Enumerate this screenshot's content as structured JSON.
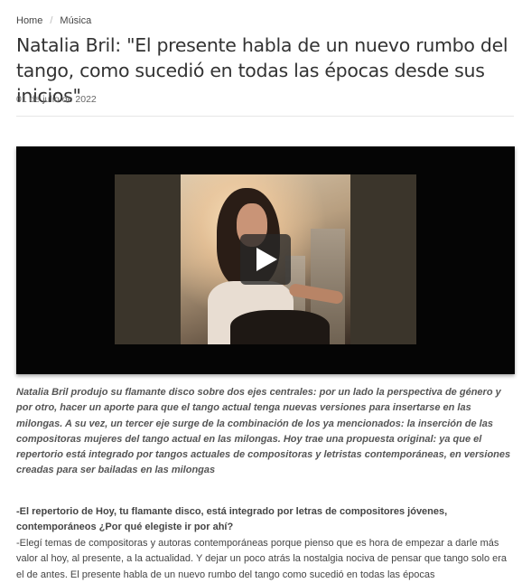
{
  "breadcrumb": {
    "home": "Home",
    "separator": "/",
    "section": "Música"
  },
  "article": {
    "title": "Natalia Bril: \"El presente habla de un nuevo rumbo del tango, como sucedió en todas las épocas desde sus inicios\"",
    "date": "01 de julio de 2022",
    "intro": "Natalia Bril produjo su flamante disco sobre dos ejes centrales: por un lado la perspectiva de género y por otro, hacer un aporte para que el tango actual tenga nuevas versiones para insertarse en las milongas. A su vez, un tercer eje surge de la combinación de los ya mencionados: la inserción de las compositoras mujeres del tango actual en las milongas. Hoy trae una propuesta original: ya que el repertorio está integrado por tangos actuales de compositoras y letristas contemporáneas, en versiones creadas para ser bailadas en las milongas",
    "question": "-El repertorio de Hoy, tu flamante disco, está integrado por letras de compositores jóvenes, contemporáneos ¿Por qué elegiste ir por ahí?",
    "answer": "-Elegí temas de compositoras y autoras contemporáneas porque pienso que es hora de empezar a darle más valor al hoy, al presente, a la actualidad. Y dejar un poco atrás la nostalgia nociva de pensar que tango solo era el de antes. El presente habla de un nuevo rumbo del tango como sucedió en todas las épocas"
  },
  "video": {
    "play_icon": "play-icon"
  }
}
